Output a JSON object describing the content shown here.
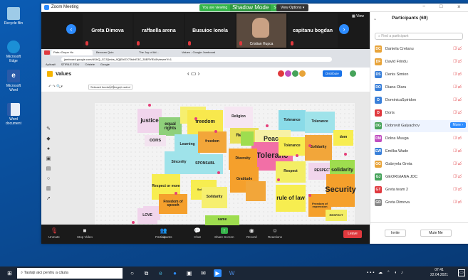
{
  "colors": {
    "accent": "#2d8cff",
    "danger": "#e0393e",
    "shadow_green": "#35b44a"
  },
  "desktop": {
    "icons": [
      "Recycle Bin",
      "Microsoft Edge",
      "Microsoft Word",
      "Word document"
    ]
  },
  "window": {
    "title": "Zoom Meeting",
    "banner_left": "You are viewing",
    "banner_center": "Shadow Mode",
    "banner_right": "Screen",
    "view_options": "View Options",
    "controls": [
      "−",
      "□",
      "×"
    ]
  },
  "gallery": {
    "view_label": "View",
    "tiles": [
      "Greta Dimova",
      "raffaella arena",
      "Busuioc Ionela",
      "Cristian Hupca",
      "capitanu bogdan"
    ]
  },
  "browser": {
    "tabs": [
      "Patru Grupe Hu",
      "Berozan Quin",
      "The Joy of Ad...",
      "Values - Google Jamboard"
    ],
    "url": "jamboard.google.com/d/1bQ_G7JQmbs_9QjEbOX7JtolvE3C_35ERYBV8/viewer?f=1",
    "bookmarks": [
      "Aplicații",
      "ȘTIRILE ZIDU",
      "Cristele",
      "Google"
    ],
    "jam_title": "Values",
    "share_btn": "Distribuie",
    "zoom_btn": "Setează fundalul",
    "clear_btn": "Ștergeți cadrul"
  },
  "notes": [
    {
      "text": "justice",
      "color": "#f1d5ec"
    },
    {
      "text": "equal rights",
      "color": "#8fd07b"
    },
    {
      "text": "cons",
      "color": "#f3e3f0"
    },
    {
      "text": "",
      "color": "#f6ef6f"
    },
    {
      "text": "freedom",
      "color": "#f8e84d"
    },
    {
      "text": "Religion",
      "color": "#f6e6f2"
    },
    {
      "text": "Respect",
      "color": "#e8e05a"
    },
    {
      "text": "Tolerance",
      "color": "#8adbe8"
    },
    {
      "text": "Tolerance",
      "color": "#9fe3ea"
    },
    {
      "text": "Learning",
      "color": "#9fe3ea"
    },
    {
      "text": "freedom",
      "color": "#f2a63a"
    },
    {
      "text": "Peace",
      "color": "#f7f1a5"
    },
    {
      "text": "Toleranc",
      "color": "#f26fa6"
    },
    {
      "text": "Tolerance",
      "color": "#f7ed50"
    },
    {
      "text": "Solidarity",
      "color": "#f2a63a"
    },
    {
      "text": "dom",
      "color": "#f7ed50"
    },
    {
      "text": "Sincerity",
      "color": "#9fe3ea"
    },
    {
      "text": "SPONSABL",
      "color": "#9fe3ea"
    },
    {
      "text": "Diversity",
      "color": "#f5a02c"
    },
    {
      "text": "Respect",
      "color": "#f3ee64"
    },
    {
      "text": "RESPECT",
      "color": "#f1d5ec"
    },
    {
      "text": "solidarity",
      "color": "#9edd4f"
    },
    {
      "text": "Respect or mom",
      "color": "#f7ed50"
    },
    {
      "text": "Gratitude",
      "color": "#f5a02c"
    },
    {
      "text": "LOVE",
      "color": "#f1d5ec"
    },
    {
      "text": "Security",
      "color": "#f5a02c"
    },
    {
      "text": "Freedom of speech",
      "color": "#f5a02c"
    },
    {
      "text": "Solidarity",
      "color": "#f7ed50"
    },
    {
      "text": "rule of law",
      "color": "#f7ed50"
    },
    {
      "text": "Freedom of expression",
      "color": "#f5a02c"
    },
    {
      "text": "LOVE",
      "color": "#f1d5ec"
    },
    {
      "text": "RESPECT",
      "color": "#f3ee64"
    },
    {
      "text": "",
      "color": "#f2a63a"
    },
    {
      "text": "Solidarity",
      "color": "#f6ef6f"
    },
    {
      "text": "",
      "color": "#9edd4f"
    },
    {
      "text": "same",
      "color": "#9edd4f"
    }
  ],
  "toolbar": {
    "unmute": "Unmute",
    "stop_video": "Stop Video",
    "participants": "Participants",
    "participants_count": "69",
    "chat": "Chat",
    "share": "Share Screen",
    "record": "Record",
    "reactions": "Reactions",
    "leave": "Leave"
  },
  "panel": {
    "title": "Participants (69)",
    "search_placeholder": "Find a participant",
    "more": "More",
    "invite": "Invite",
    "mute_all": "Mute Me",
    "participants": [
      {
        "initials": "DC",
        "name": "Daniela Cretanu",
        "color": "#e8a43a"
      },
      {
        "initials": "DF",
        "name": "David Frindu",
        "color": "#e8a43a"
      },
      {
        "initials": "DS",
        "name": "Denis Simion",
        "color": "#3a80d9"
      },
      {
        "initials": "DO",
        "name": "Diana Olaru",
        "color": "#3a80d9"
      },
      {
        "initials": "D",
        "name": "DominicaSpiridon",
        "color": "#3a80d9"
      },
      {
        "initials": "D",
        "name": "Doris",
        "color": "#e0393e"
      },
      {
        "initials": "DG",
        "name": "Dobrovit Galyachov",
        "color": "#46a35a"
      },
      {
        "initials": "DM",
        "name": "Dolna Muuga",
        "color": "#c04ec0"
      },
      {
        "initials": "EW",
        "name": "Emilka Wade",
        "color": "#3a80d9"
      },
      {
        "initials": "GG",
        "name": "Gabryela Greta",
        "color": "#e8a43a"
      },
      {
        "initials": "GJ",
        "name": "GEORGIANA JDC",
        "color": "#46a35a"
      },
      {
        "initials": "GT",
        "name": "Greta team 2",
        "color": "#e0393e"
      },
      {
        "initials": "GD",
        "name": "Greta Dimova",
        "color": "#888"
      }
    ]
  },
  "taskbar": {
    "search": "Tastați aici pentru a căuta",
    "time": "07:41",
    "date": "22.04.2021"
  }
}
